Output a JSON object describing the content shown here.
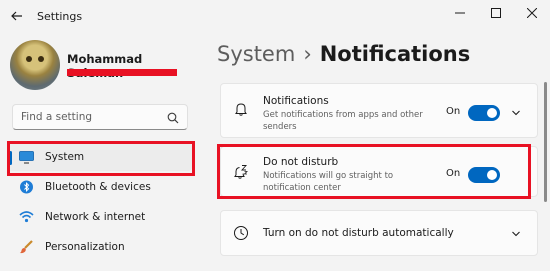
{
  "window": {
    "title": "Settings"
  },
  "profile": {
    "name": "Mohammad Suleman"
  },
  "search": {
    "placeholder": "Find a setting"
  },
  "sidebar": {
    "items": [
      {
        "label": "System",
        "icon": "monitor-icon",
        "selected": true
      },
      {
        "label": "Bluetooth & devices",
        "icon": "bluetooth-icon",
        "selected": false
      },
      {
        "label": "Network & internet",
        "icon": "wifi-icon",
        "selected": false
      },
      {
        "label": "Personalization",
        "icon": "paintbrush-icon",
        "selected": false
      }
    ]
  },
  "header": {
    "breadcrumb": "System",
    "separator": "›",
    "title": "Notifications"
  },
  "settings": [
    {
      "title": "Notifications",
      "description": "Get notifications from apps and other senders",
      "state": "On",
      "toggle_on": true,
      "icon": "bell-icon"
    },
    {
      "title": "Do not disturb",
      "description": "Notifications will go straight to notification center",
      "state": "On",
      "toggle_on": true,
      "icon": "bell-zz-icon"
    },
    {
      "title": "Turn on do not disturb automatically",
      "icon": "clock-icon"
    }
  ],
  "colors": {
    "accent": "#0067c0",
    "highlight": "#e81123",
    "background": "#f3f3f3"
  }
}
